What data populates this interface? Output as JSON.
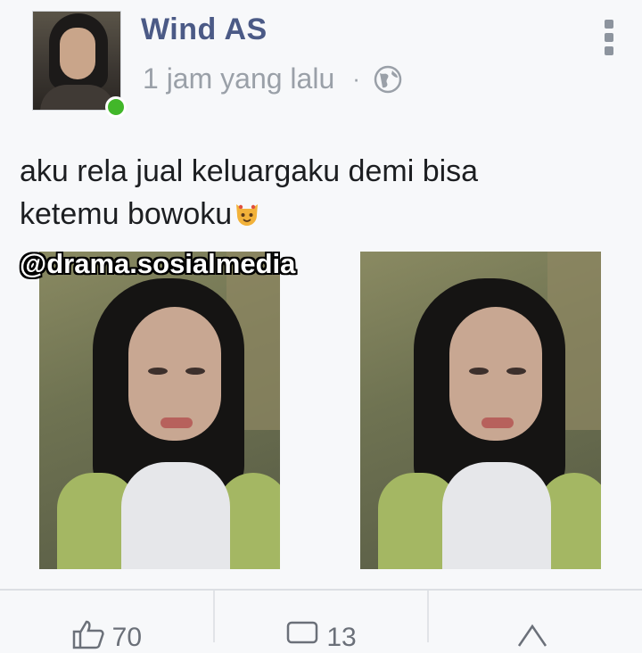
{
  "post": {
    "author_name": "Wind AS",
    "timestamp": "1 jam yang lalu",
    "separator": "·",
    "privacy_icon": "globe-icon",
    "menu_icon": "vertical-dots-icon",
    "online_color": "#42b72a",
    "text_line_1": "aku rela jual keluargaku demi bisa",
    "text_line_2": "ketemu bowoku",
    "text_emoji": "cat-face-emoji",
    "photos": [
      {
        "icon": "selfie-photo"
      },
      {
        "icon": "selfie-photo"
      }
    ]
  },
  "watermark": "@drama.sosialmedia",
  "actions": {
    "like_count": "70",
    "comment_count": "13",
    "like_icon": "thumbs-up-icon",
    "comment_icon": "comment-icon",
    "share_icon": "share-icon"
  },
  "colors": {
    "author": "#4b5a86",
    "meta": "#9aa0a8",
    "text": "#1c1e21",
    "background": "#f7f8fa"
  }
}
